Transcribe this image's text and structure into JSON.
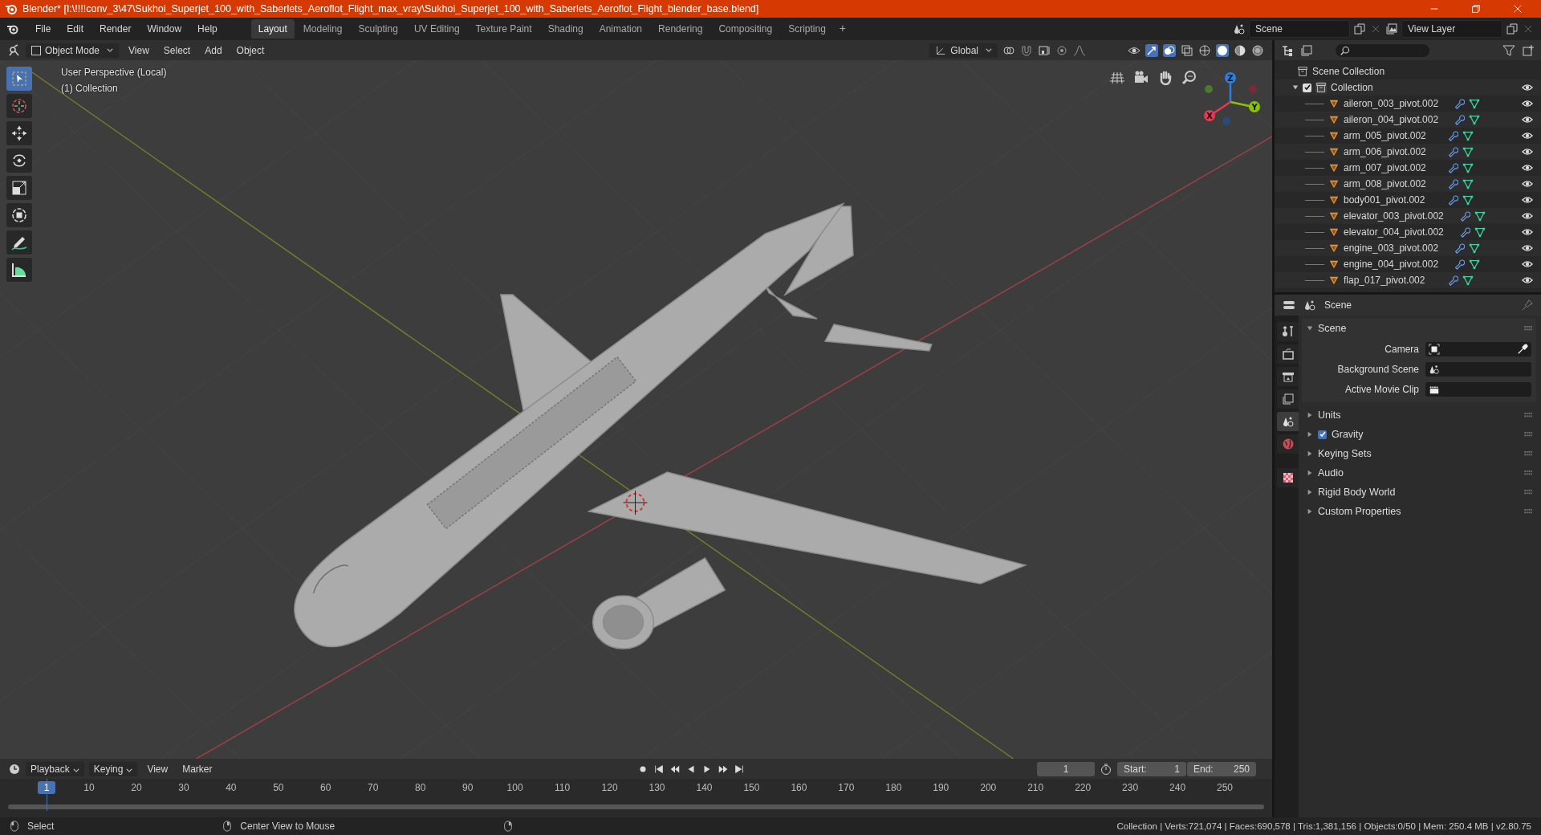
{
  "window": {
    "title": "Blender* [I:\\!!!!conv_3\\47\\Sukhoi_Superjet_100_with_Saberlets_Aeroflot_Flight_max_vray\\Sukhoi_Superjet_100_with_Saberlets_Aeroflot_Flight_blender_base.blend]"
  },
  "menu": [
    "File",
    "Edit",
    "Render",
    "Window",
    "Help"
  ],
  "workspaces": [
    {
      "label": "Layout",
      "selected": true
    },
    {
      "label": "Modeling",
      "selected": false
    },
    {
      "label": "Sculpting",
      "selected": false
    },
    {
      "label": "UV Editing",
      "selected": false
    },
    {
      "label": "Texture Paint",
      "selected": false
    },
    {
      "label": "Shading",
      "selected": false
    },
    {
      "label": "Animation",
      "selected": false
    },
    {
      "label": "Rendering",
      "selected": false
    },
    {
      "label": "Compositing",
      "selected": false
    },
    {
      "label": "Scripting",
      "selected": false
    }
  ],
  "add_workspace": "+",
  "scene_selector": {
    "value": "Scene"
  },
  "view_layer": {
    "value": "View Layer"
  },
  "viewport": {
    "mode": "Object Mode",
    "menus": [
      "View",
      "Select",
      "Add",
      "Object"
    ],
    "orientation": "Global",
    "perspective": "User Perspective (Local)",
    "collection": "(1) Collection",
    "tools": [
      {
        "kind": "select",
        "selected": true
      },
      {
        "kind": "cursor",
        "selected": false
      },
      {
        "kind": "move",
        "selected": false
      },
      {
        "kind": "rotate",
        "selected": false
      },
      {
        "kind": "scale",
        "selected": false
      },
      {
        "kind": "transform",
        "selected": false
      },
      {
        "kind": "annotate",
        "selected": false
      },
      {
        "kind": "measure",
        "selected": false
      }
    ],
    "gizmo_axes": [
      {
        "label": "Z",
        "color": "#2b7fe0"
      },
      {
        "label": "Y",
        "color": "#8bc400"
      },
      {
        "label": "X",
        "color": "#e8384f"
      }
    ]
  },
  "outliner": {
    "root": "Scene Collection",
    "collection": {
      "name": "Collection",
      "expanded": true,
      "checked": true,
      "children": [
        {
          "name": "aileron_003_pivot.002"
        },
        {
          "name": "aileron_004_pivot.002"
        },
        {
          "name": "arm_005_pivot.002"
        },
        {
          "name": "arm_006_pivot.002"
        },
        {
          "name": "arm_007_pivot.002"
        },
        {
          "name": "arm_008_pivot.002"
        },
        {
          "name": "body001_pivot.002"
        },
        {
          "name": "elevator_003_pivot.002"
        },
        {
          "name": "elevator_004_pivot.002"
        },
        {
          "name": "engine_003_pivot.002"
        },
        {
          "name": "engine_004_pivot.002"
        },
        {
          "name": "flap_017_pivot.002"
        }
      ]
    }
  },
  "properties": {
    "header": "Scene",
    "tabs": [
      {
        "kind": "tool",
        "selected": false
      },
      {
        "kind": "render",
        "selected": false
      },
      {
        "kind": "output",
        "selected": false
      },
      {
        "kind": "view_layer",
        "selected": false
      },
      {
        "kind": "scene",
        "selected": true
      },
      {
        "kind": "world",
        "selected": false
      },
      {
        "kind": "texture",
        "selected": false
      }
    ],
    "panels": [
      {
        "title": "Scene",
        "expanded": true,
        "fields": [
          {
            "label": "Camera",
            "kind": "camera"
          },
          {
            "label": "Background Scene",
            "kind": "scene"
          },
          {
            "label": "Active Movie Clip",
            "kind": "clip"
          }
        ]
      },
      {
        "title": "Units",
        "expanded": false
      },
      {
        "title": "Gravity",
        "expanded": false,
        "checked": true
      },
      {
        "title": "Keying Sets",
        "expanded": false
      },
      {
        "title": "Audio",
        "expanded": false
      },
      {
        "title": "Rigid Body World",
        "expanded": false
      },
      {
        "title": "Custom Properties",
        "expanded": false
      }
    ]
  },
  "timeline": {
    "menus": [
      "Playback",
      "Keying",
      "View",
      "Marker"
    ],
    "current_frame": "1",
    "start_label": "Start:",
    "start": "1",
    "end_label": "End:",
    "end": "250",
    "playhead": "1",
    "ticks": [
      "10",
      "20",
      "30",
      "40",
      "50",
      "60",
      "70",
      "80",
      "90",
      "100",
      "110",
      "120",
      "130",
      "140",
      "150",
      "160",
      "170",
      "180",
      "190",
      "200",
      "210",
      "220",
      "230",
      "240",
      "250"
    ]
  },
  "status_bar": {
    "hints": [
      {
        "label": "Select"
      },
      {
        "label": "Center View to Mouse"
      }
    ],
    "stats": "Collection | Verts:721,074 | Faces:690,578 | Tris:1,381,156 | Objects:0/50 | Mem: 250.4 MB | v2.80.75"
  }
}
